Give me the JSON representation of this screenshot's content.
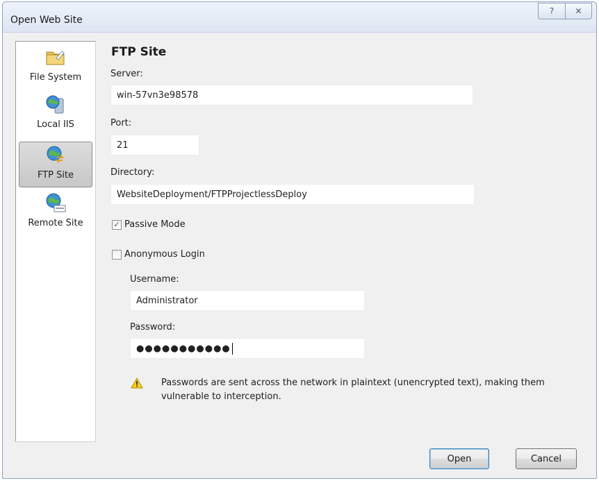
{
  "window": {
    "title": "Open Web Site",
    "help_glyph": "?",
    "close_glyph": "✕"
  },
  "sidebar": {
    "items": [
      {
        "label": "File System",
        "icon": "folder-icon",
        "selected": false
      },
      {
        "label": "Local IIS",
        "icon": "server-globe-icon",
        "selected": false
      },
      {
        "label": "FTP Site",
        "icon": "ftp-globe-icon",
        "selected": true
      },
      {
        "label": "Remote Site",
        "icon": "http-globe-icon",
        "selected": false
      }
    ]
  },
  "form": {
    "heading": "FTP Site",
    "server_label": "Server:",
    "server_value": "win-57vn3e98578",
    "port_label": "Port:",
    "port_value": "21",
    "directory_label": "Directory:",
    "directory_value": "WebsiteDeployment/FTPProjectlessDeploy",
    "passive_label": "Passive Mode",
    "passive_checked": true,
    "anonymous_label": "Anonymous Login",
    "anonymous_checked": false,
    "username_label": "Username:",
    "username_value": "Administrator",
    "password_label": "Password:",
    "password_value": "●●●●●●●●●●●"
  },
  "warning": {
    "icon": "warning-icon",
    "text": "Passwords are sent across the network in plaintext (unencrypted text), making them vulnerable to interception."
  },
  "buttons": {
    "open": "Open",
    "cancel": "Cancel"
  },
  "colors": {
    "accent": "#3c7fb1",
    "warning_yellow": "#f5d020"
  }
}
